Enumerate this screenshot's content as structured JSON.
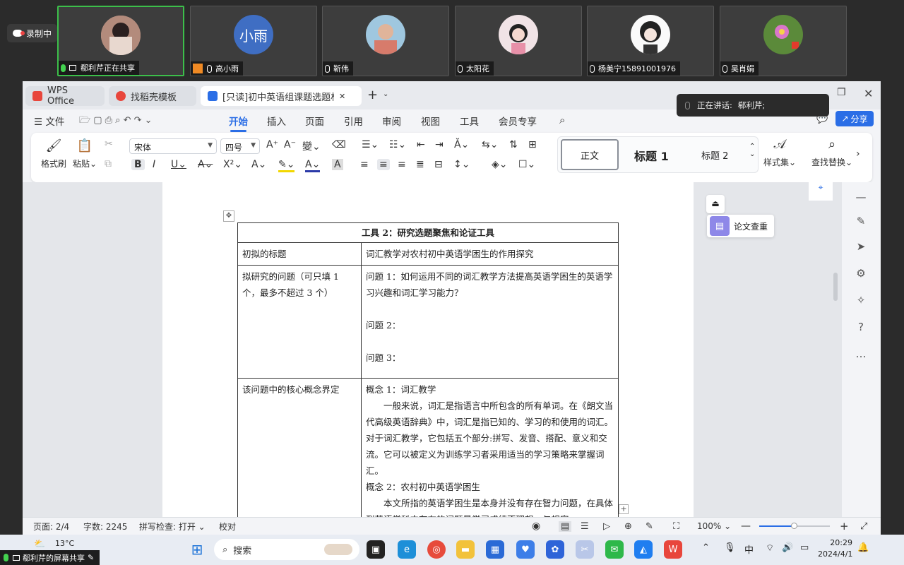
{
  "meeting": {
    "recording_label": "录制中",
    "participants": [
      {
        "name": "郗利芹正在共享",
        "active": true,
        "avatar_text": ""
      },
      {
        "name": "高小雨",
        "active": false,
        "avatar_text": "小雨"
      },
      {
        "name": "靳伟",
        "active": false,
        "avatar_text": ""
      },
      {
        "name": "太阳花",
        "active": false,
        "avatar_text": ""
      },
      {
        "name": "杨美宁15891001976",
        "active": false,
        "avatar_text": ""
      },
      {
        "name": "吴肖娟",
        "active": false,
        "avatar_text": ""
      }
    ],
    "speaking_label": "正在讲话:",
    "speaking_name": "郗利芹;",
    "screenshare_label": "郗利芹的屏幕共享"
  },
  "tabs": [
    {
      "label": "WPS Office"
    },
    {
      "label": "找稻壳模板"
    },
    {
      "label": "[只读]初中英语组课题选题材料"
    }
  ],
  "menu": {
    "file": "文件",
    "items": [
      "开始",
      "插入",
      "页面",
      "引用",
      "审阅",
      "视图",
      "工具",
      "会员专享"
    ],
    "share": "分享"
  },
  "ribbon": {
    "format_painter": "格式刷",
    "paste": "粘贴",
    "font_name": "宋体",
    "font_size": "四号",
    "styles": [
      "正文",
      "标题 1",
      "标题 2"
    ],
    "style_set": "样式集",
    "find_replace": "查找替换"
  },
  "sidepanel": {
    "paper_check": "论文查重"
  },
  "document": {
    "table_title": "工具 2：研究选题聚焦和论证工具",
    "row1_label": "初拟的标题",
    "row1_value": "词汇教学对农村初中英语学困生的作用探究",
    "row2_label": "拟研究的问题（可只填 1 个，最多不超过 3 个）",
    "q1": "问题 1：如何运用不同的词汇教学方法提高英语学困生的英语学习兴趣和词汇学习能力？",
    "q2": "问题 2：",
    "q3": "问题 3：",
    "row3_label": "该问题中的核心概念界定",
    "c1_title": "概念 1：词汇教学",
    "c1_body": "一般来说，词汇是指语言中所包含的所有单词。在《朗文当代高级英语辞典》中，词汇是指已知的、学习的和使用的词汇。对于词汇教学，它包括五个部分:拼写、发音、搭配、意义和交流。它可以被定义为训练学习者采用适当的学习策略来掌握词汇。",
    "c2_title": "概念 2：农村初中英语学困生",
    "c2_body": "本文所指的英语学困生是本身并没有存在智力问题，在具体到英语学科中存在的问题是学习成绩不理想，与规定"
  },
  "status": {
    "page": "页面: 2/4",
    "words": "字数: 2245",
    "spellcheck": "拼写检查: 打开",
    "proof": "校对",
    "zoom": "100%"
  },
  "taskbar": {
    "weather": "13°C",
    "search": "搜索",
    "ime": "中",
    "time": "20:29",
    "date": "2024/4/1"
  }
}
